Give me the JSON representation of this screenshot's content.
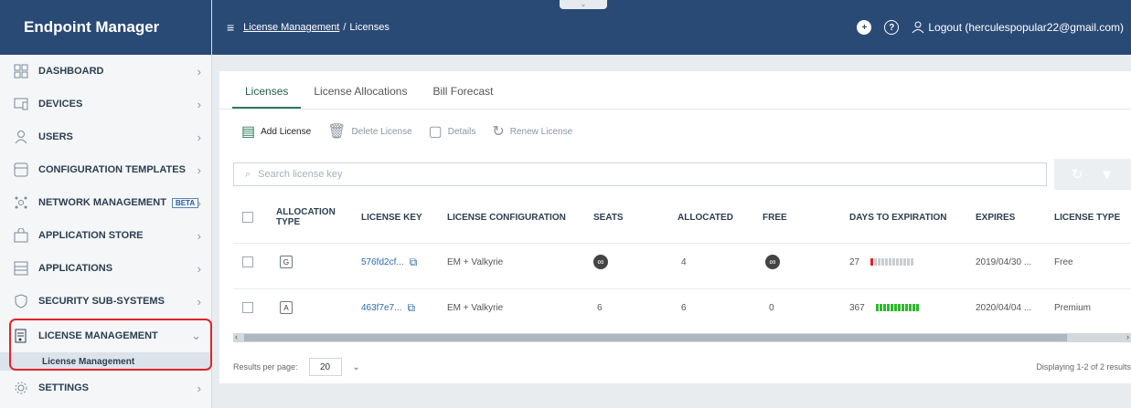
{
  "brand": "Endpoint Manager",
  "topbar": {
    "breadcrumb_link": "License Management",
    "breadcrumb_sep": "/",
    "breadcrumb_current": "Licenses",
    "logout_label": "Logout (herculespopular22@gmail.com)"
  },
  "sidebar": {
    "items": [
      {
        "label": "DASHBOARD",
        "icon": "dashboard-icon"
      },
      {
        "label": "DEVICES",
        "icon": "devices-icon"
      },
      {
        "label": "USERS",
        "icon": "users-icon"
      },
      {
        "label": "CONFIGURATION TEMPLATES",
        "icon": "config-templates-icon"
      },
      {
        "label": "NETWORK MANAGEMENT",
        "icon": "network-icon",
        "badge": "BETA"
      },
      {
        "label": "APPLICATION STORE",
        "icon": "app-store-icon"
      },
      {
        "label": "APPLICATIONS",
        "icon": "applications-icon"
      },
      {
        "label": "SECURITY SUB-SYSTEMS",
        "icon": "shield-icon"
      },
      {
        "label": "LICENSE MANAGEMENT",
        "icon": "license-icon"
      },
      {
        "label": "SETTINGS",
        "icon": "gear-icon"
      }
    ],
    "sub_item": "License Management"
  },
  "tabs": [
    "Licenses",
    "License Allocations",
    "Bill Forecast"
  ],
  "toolbar": {
    "add": "Add License",
    "delete": "Delete License",
    "details": "Details",
    "renew": "Renew License"
  },
  "search": {
    "placeholder": "Search license key"
  },
  "table": {
    "headers": {
      "allocation_type_1": "ALLOCATION",
      "allocation_type_2": "TYPE",
      "license_key": "LICENSE KEY",
      "license_configuration": "LICENSE CONFIGURATION",
      "seats": "SEATS",
      "allocated": "ALLOCATED",
      "free": "FREE",
      "days_to_expiration": "DAYS TO EXPIRATION",
      "expires": "EXPIRES",
      "license_type": "LICENSE TYPE"
    },
    "rows": [
      {
        "alloc": "G",
        "key": "576fd2cf...",
        "config": "EM + Valkyrie",
        "seats": "∞",
        "allocated": "4",
        "free": "∞",
        "days": "27",
        "expires": "2019/04/30 ...",
        "type": "Free"
      },
      {
        "alloc": "A",
        "key": "463f7e7...",
        "config": "EM + Valkyrie",
        "seats": "6",
        "allocated": "6",
        "free": "0",
        "days": "367",
        "expires": "2020/04/04 ...",
        "type": "Premium"
      }
    ]
  },
  "footer": {
    "results_per_page_label": "Results per page:",
    "results_per_page_value": "20",
    "displaying": "Displaying 1-2 of 2 results"
  },
  "colors": {
    "header_bg": "#2a4a76",
    "accent_green": "#2c7a5c",
    "highlight_red": "#e0242a"
  }
}
